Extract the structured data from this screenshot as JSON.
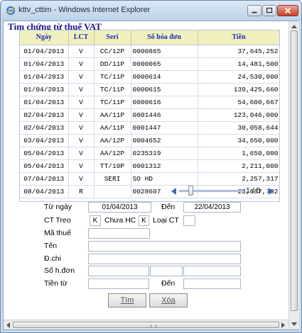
{
  "window": {
    "title": "kttv_cttim - Windows Internet Explorer"
  },
  "page": {
    "title": "Tìm chứng từ thuế VAT"
  },
  "table": {
    "headers": [
      "Ngày",
      "LCT",
      "Seri",
      "Số hóa đơn",
      "Tiền"
    ],
    "rows": [
      [
        "01/04/2013",
        "V",
        "CC/12P",
        "0000865",
        "37,645,252"
      ],
      [
        "01/04/2013",
        "V",
        "DD/11P",
        "0000065",
        "14,481,500"
      ],
      [
        "01/04/2013",
        "V",
        "TC/11P",
        "0000614",
        "24,530,000"
      ],
      [
        "01/04/2013",
        "V",
        "TC/11P",
        "0000615",
        "139,425,660"
      ],
      [
        "01/04/2013",
        "V",
        "TC/11P",
        "0000616",
        "54,600,667"
      ],
      [
        "02/04/2013",
        "V",
        "AA/11P",
        "0001446",
        "123,046,000"
      ],
      [
        "02/04/2013",
        "V",
        "AA/11P",
        "0001447",
        "30,058,644"
      ],
      [
        "03/04/2013",
        "V",
        "AA/12P",
        "0004652",
        "34,650,000"
      ],
      [
        "05/04/2013",
        "V",
        "AA/12P",
        "0235319",
        "1,650,000"
      ],
      [
        "05/04/2013",
        "V",
        "TT/10P",
        "0001312",
        "2,211,000"
      ],
      [
        "07/04/2013",
        "V",
        "SERI",
        "SO HD",
        "2,257,317"
      ],
      [
        "08/04/2013",
        "R",
        "",
        "0028607",
        "23,687,782"
      ]
    ]
  },
  "pager": {
    "text": "1 / 5",
    "position": 0.15
  },
  "form": {
    "from_date_label": "Từ ngày",
    "from_date_value": "01/04/2013",
    "to_date_label": "Đến",
    "to_date_value": "22/04/2013",
    "ct_treo_label": "CT Treo",
    "ct_treo_value": "K",
    "chua_hc_label": "Chưa HC",
    "chua_hc_value": "K",
    "loai_ct_label": "Loại CT",
    "loai_ct_value": "",
    "ma_thue_label": "Mã thuế",
    "ma_thue_value": "",
    "ten_label": "Tên",
    "ten_value": "",
    "dchi_label": "Đ.chi",
    "dchi_value": "",
    "so_hdon_label": "Số h.đơn",
    "so_hdon_value_1": "",
    "so_hdon_value_2": "",
    "so_hdon_value_3": "",
    "tien_tu_label": "Tiền từ",
    "tien_tu_value": "",
    "tien_den_label": "Đến",
    "tien_den_value": ""
  },
  "buttons": {
    "search": "Tìm",
    "clear": "Xóa"
  },
  "colors": {
    "header_bg": "#f0f0be",
    "header_text": "#1c2bb3",
    "title_text": "#17138f"
  }
}
